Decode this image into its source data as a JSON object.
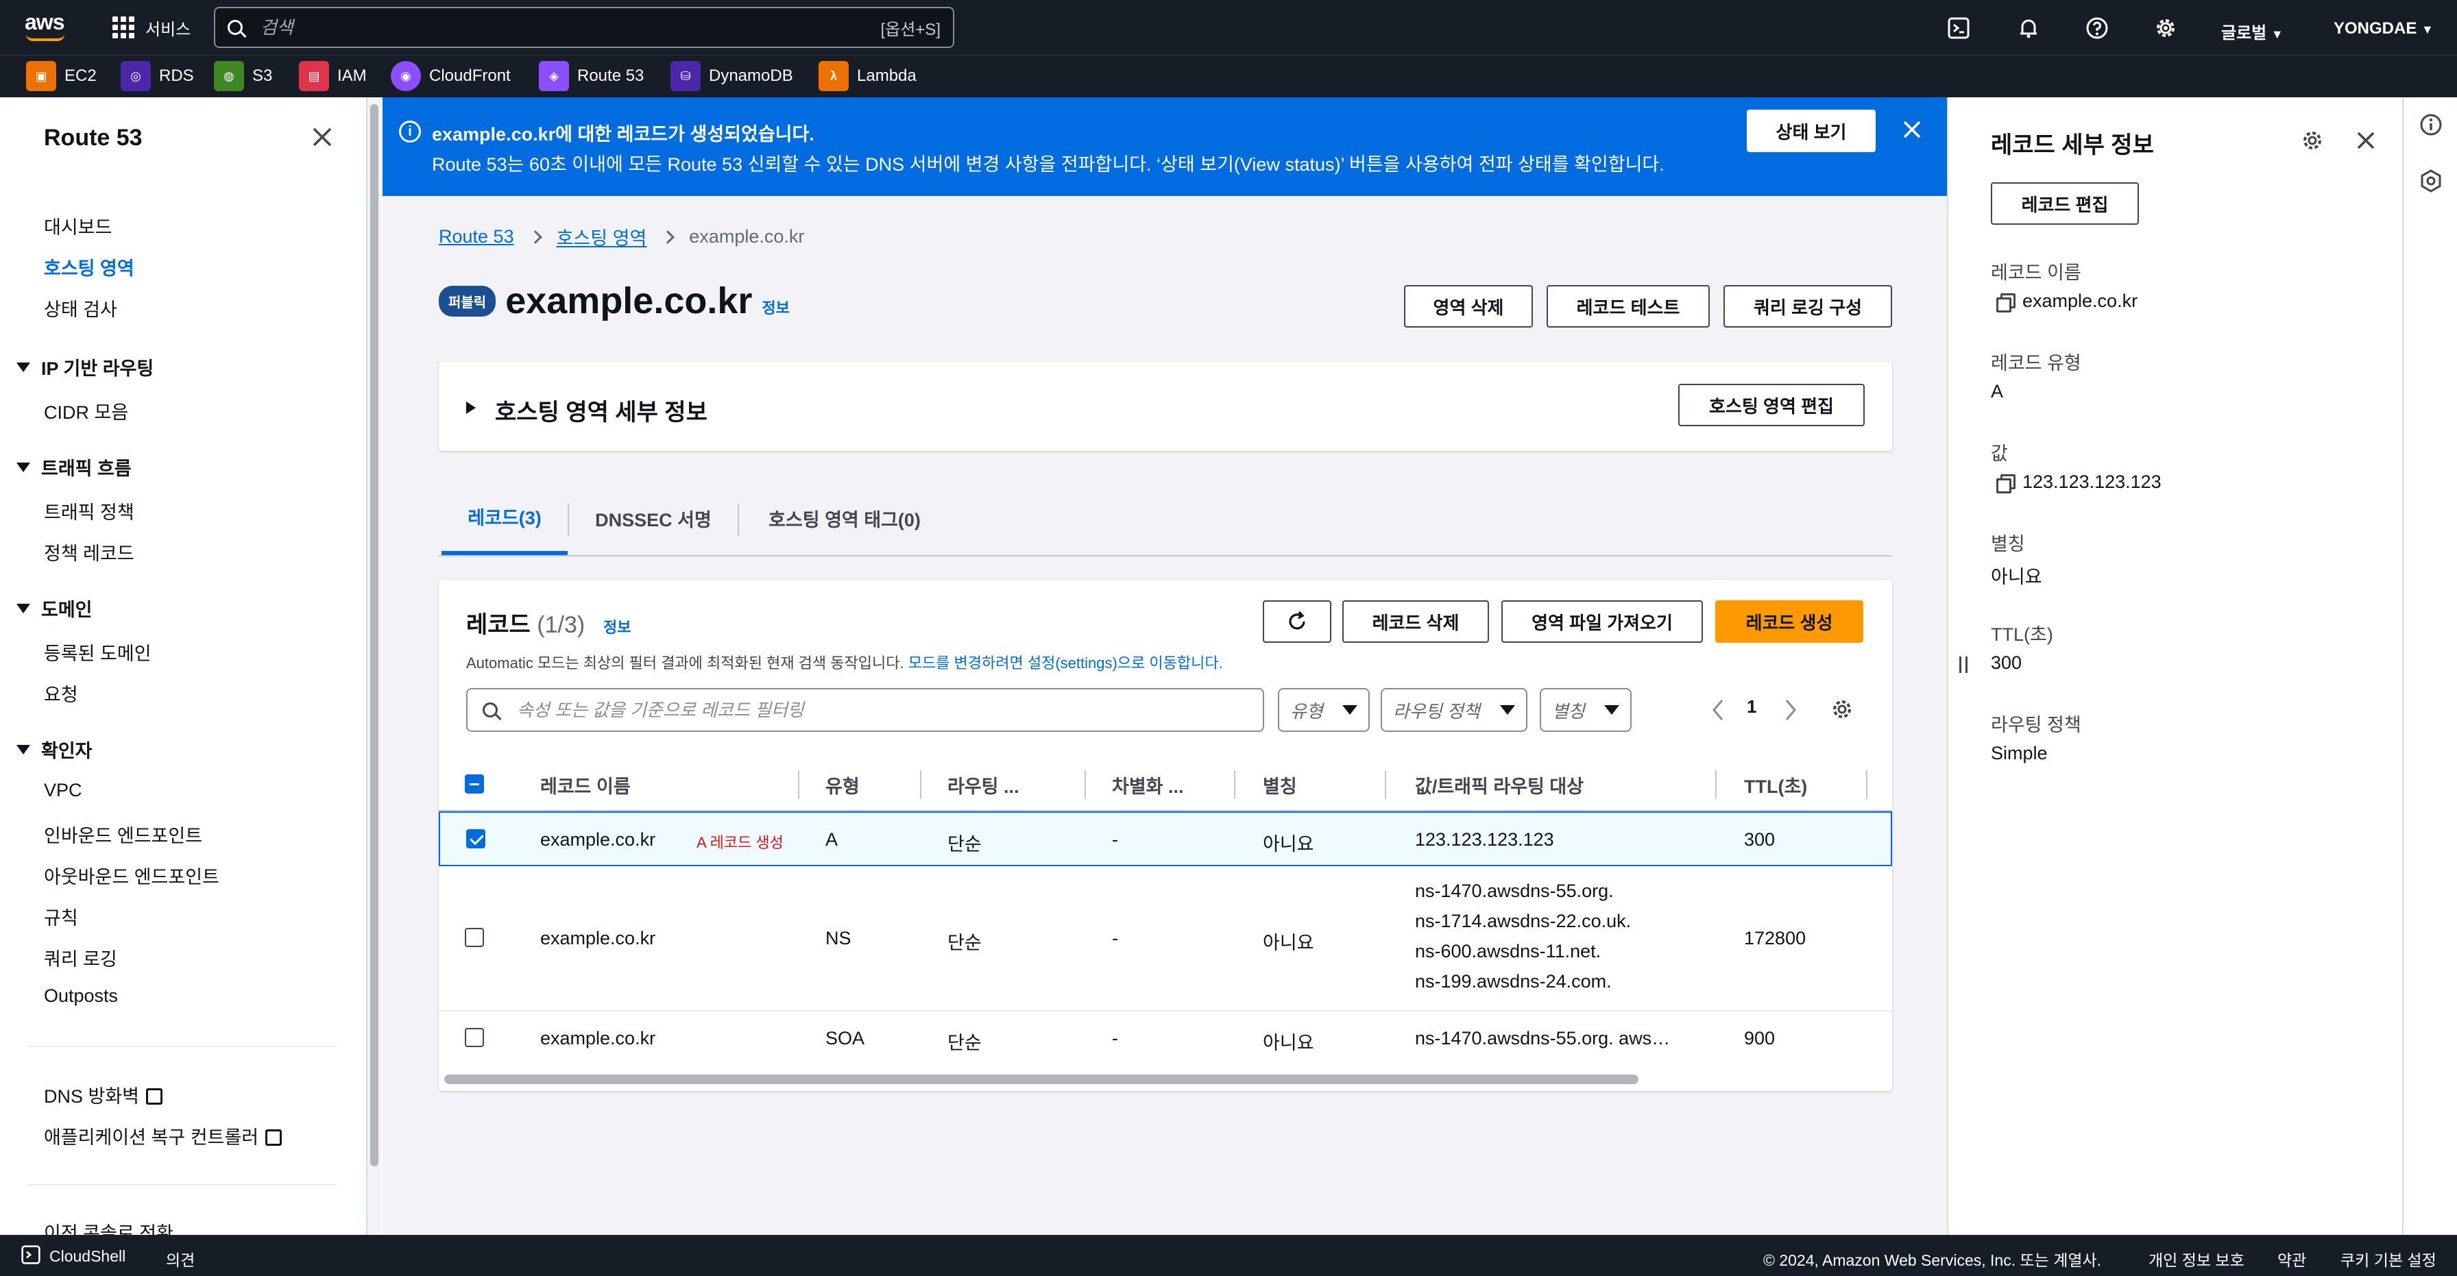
{
  "topnav": {
    "logo": "aws",
    "services_label": "서비스",
    "search_placeholder": "검색",
    "search_shortcut": "[옵션+S]",
    "region_label": "글로벌",
    "user_label": "YONGDAE",
    "icons": [
      "cloudshell-icon",
      "bell-icon",
      "help-icon",
      "gear-icon"
    ]
  },
  "favorites": [
    {
      "label": "EC2",
      "color": "#ed7100",
      "icon": "ec2-icon"
    },
    {
      "label": "RDS",
      "color": "#4d27aa",
      "icon": "rds-icon"
    },
    {
      "label": "S3",
      "color": "#3f8624",
      "icon": "s3-icon"
    },
    {
      "label": "IAM",
      "color": "#dd344c",
      "icon": "iam-icon"
    },
    {
      "label": "CloudFront",
      "color": "#8c4fff",
      "icon": "cloudfront-icon"
    },
    {
      "label": "Route 53",
      "color": "#8c4fff",
      "icon": "route53-icon"
    },
    {
      "label": "DynamoDB",
      "color": "#4d27aa",
      "icon": "dynamodb-icon"
    },
    {
      "label": "Lambda",
      "color": "#ed7100",
      "icon": "lambda-icon"
    }
  ],
  "sidebar": {
    "title": "Route 53",
    "items": [
      {
        "label": "대시보드"
      },
      {
        "label": "호스팅 영역",
        "active": true
      },
      {
        "label": "상태 검사"
      }
    ],
    "sections": [
      {
        "title": "IP 기반 라우팅",
        "items": [
          "CIDR 모음"
        ]
      },
      {
        "title": "트래픽 흐름",
        "items": [
          "트래픽 정책",
          "정책 레코드"
        ]
      },
      {
        "title": "도메인",
        "items": [
          "등록된 도메인",
          "요청"
        ]
      },
      {
        "title": "확인자",
        "items": [
          "VPC",
          "인바운드 엔드포인트",
          "아웃바운드 엔드포인트",
          "규칙",
          "쿼리 로깅",
          "Outposts"
        ]
      }
    ],
    "external": [
      "DNS 방화벽",
      "애플리케이션 복구 컨트롤러"
    ],
    "bottom_cut": "이전 콘솔로 전환"
  },
  "flash": {
    "title": "example.co.kr에 대한 레코드가 생성되었습니다.",
    "body": "Route 53는 60초 이내에 모든 Route 53 신뢰할 수 있는 DNS 서버에 변경 사항을 전파합니다. ‘상태 보기(View status)’ 버튼을 사용하여 전파 상태를 확인합니다.",
    "button": "상태 보기"
  },
  "breadcrumb": {
    "items": [
      "Route 53",
      "호스팅 영역"
    ],
    "current": "example.co.kr"
  },
  "header": {
    "badge": "퍼블릭",
    "title": "example.co.kr",
    "info": "정보",
    "buttons": [
      "영역 삭제",
      "레코드 테스트",
      "쿼리 로깅 구성"
    ]
  },
  "details": {
    "title": "호스팅 영역 세부 정보",
    "edit_button": "호스팅 영역 편집"
  },
  "tabs": [
    "레코드(3)",
    "DNSSEC 서명",
    "호스팅 영역 태그(0)"
  ],
  "records": {
    "title": "레코드",
    "count": "(1/3)",
    "info": "정보",
    "description_prefix": "Automatic 모드는 최상의 필터 결과에 최적화된 현재 검색 동작입니다. ",
    "description_link": "모드를 변경하려면 설정(settings)으로 이동합니다.",
    "buttons": {
      "delete": "레코드 삭제",
      "import": "영역 파일 가져오기",
      "create": "레코드 생성"
    },
    "filter_placeholder": "속성 또는 값을 기준으로 레코드 필터링",
    "filters": [
      "유형",
      "라우팅 정책",
      "별칭"
    ],
    "page": "1",
    "columns": [
      "레코드 이름",
      "유형",
      "라우팅 ...",
      "차별화 ...",
      "별칭",
      "값/트래픽 라우팅 대상",
      "TTL(초)"
    ],
    "new_label": "A 레코드 생성",
    "rows": [
      {
        "name": "example.co.kr",
        "type": "A",
        "routing": "단순",
        "diff": "-",
        "alias": "아니요",
        "values": [
          "123.123.123.123"
        ],
        "ttl": "300",
        "selected": true
      },
      {
        "name": "example.co.kr",
        "type": "NS",
        "routing": "단순",
        "diff": "-",
        "alias": "아니요",
        "values": [
          "ns-1470.awsdns-55.org.",
          "ns-1714.awsdns-22.co.uk.",
          "ns-600.awsdns-11.net.",
          "ns-199.awsdns-24.com."
        ],
        "ttl": "172800",
        "selected": false
      },
      {
        "name": "example.co.kr",
        "type": "SOA",
        "routing": "단순",
        "diff": "-",
        "alias": "아니요",
        "values": [
          "ns-1470.awsdns-55.org. aws…"
        ],
        "ttl": "900",
        "selected": false
      }
    ]
  },
  "detail_panel": {
    "title": "레코드 세부 정보",
    "edit_button": "레코드 편집",
    "fields": [
      {
        "label": "레코드 이름",
        "value": "example.co.kr",
        "copy": true
      },
      {
        "label": "레코드 유형",
        "value": "A",
        "copy": false
      },
      {
        "label": "값",
        "value": "123.123.123.123",
        "copy": true
      },
      {
        "label": "별칭",
        "value": "아니요",
        "copy": false
      },
      {
        "label": "TTL(초)",
        "value": "300",
        "copy": false
      },
      {
        "label": "라우팅 정책",
        "value": "Simple",
        "copy": false
      }
    ]
  },
  "footer": {
    "cloudshell": "CloudShell",
    "feedback": "의견",
    "copyright": "© 2024, Amazon Web Services, Inc. 또는 계열사.",
    "privacy": "개인 정보 보호",
    "terms": "약관",
    "cookies": "쿠키 기본 설정"
  },
  "colors": {
    "nav_bg": "#161d26",
    "accent_blue": "#006ce0",
    "primary_orange": "#ff9900",
    "badge_blue": "#1b4f92"
  }
}
